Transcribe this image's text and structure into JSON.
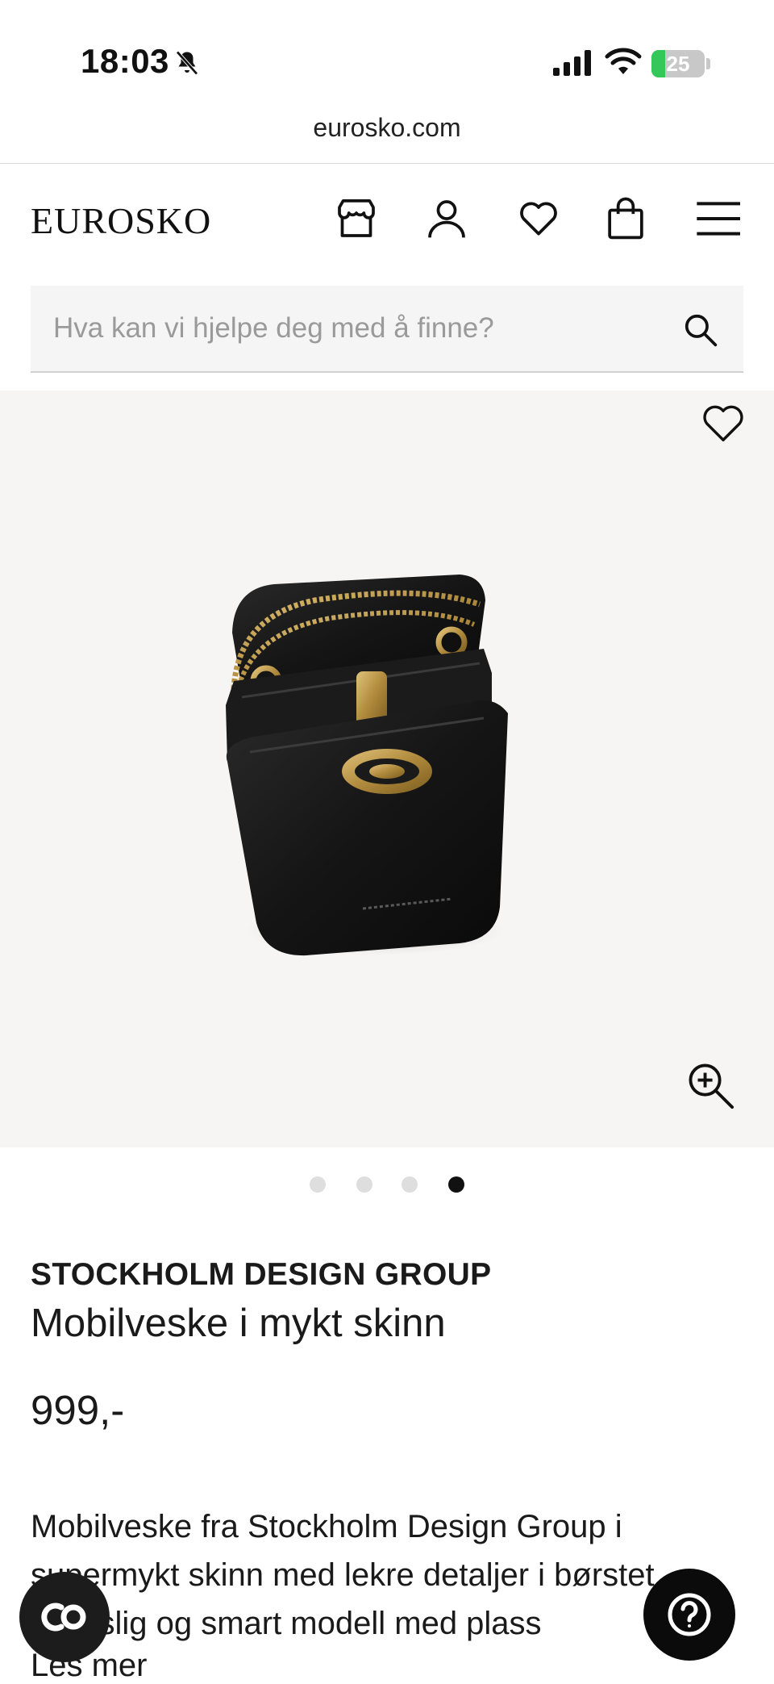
{
  "status_bar": {
    "time": "18:03",
    "battery_level": "25",
    "battery_fraction": 0.25
  },
  "browser": {
    "url": "eurosko.com"
  },
  "header": {
    "logo": "EUROSKO",
    "icons": [
      "store-icon",
      "account-icon",
      "wishlist-icon",
      "cart-icon",
      "menu-icon"
    ]
  },
  "search": {
    "placeholder": "Hva kan vi hjelpe deg med å finne?",
    "value": ""
  },
  "gallery": {
    "image_count": 4,
    "active_index": 3,
    "image_alt": "Mobilveske i mykt skinn"
  },
  "product": {
    "brand": "STOCKHOLM DESIGN GROUP",
    "name": "Mobilveske i mykt skinn",
    "price": "999,-",
    "description": "Mobilveske fra Stockholm Design Group i supermykt skinn med lekre detaljer i børstet ... Romslig og smart modell med plass",
    "read_more": "Les mer"
  },
  "colors": {
    "accent": "#111111",
    "gallery_bg": "#f6f5f3",
    "search_bg": "#f5f5f5",
    "battery": "#34c759"
  }
}
